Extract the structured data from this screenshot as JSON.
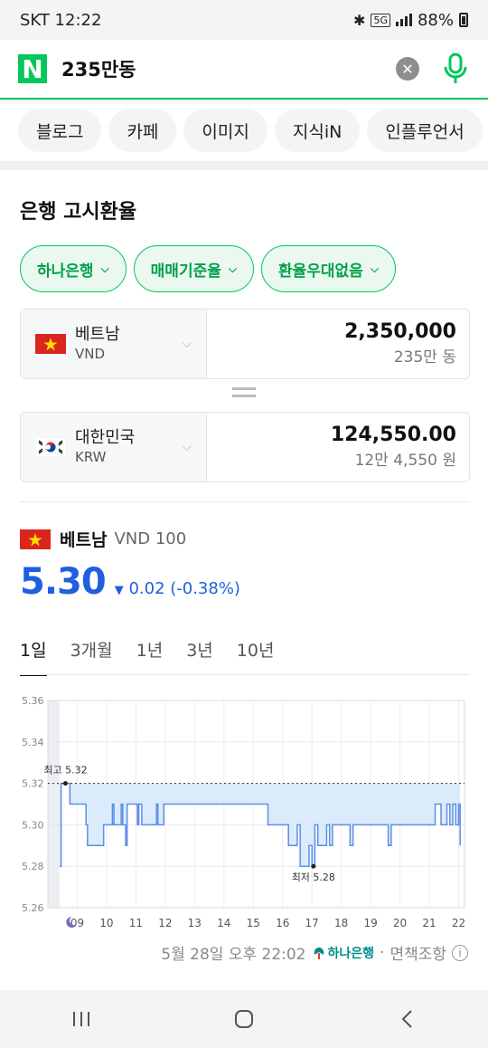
{
  "status_bar": {
    "carrier_time": "SKT 12:22",
    "network": "5G",
    "battery": "88%"
  },
  "search": {
    "query": "235만동",
    "logo": "N",
    "clear_icon": "close-icon",
    "mic_icon": "mic-icon"
  },
  "chips": [
    "블로그",
    "카페",
    "이미지",
    "지식iN",
    "인플루언서"
  ],
  "section_title": "은행 고시환율",
  "filters": [
    "하나은행",
    "매매기준율",
    "환율우대없음"
  ],
  "from": {
    "name": "베트남",
    "code": "VND",
    "amount": "2,350,000",
    "words": "235만 동"
  },
  "to": {
    "name": "대한민국",
    "code": "KRW",
    "amount": "124,550.00",
    "words": "12만 4,550 원"
  },
  "rate": {
    "country": "베트남",
    "unit": "VND 100",
    "value": "5.30",
    "change": "0.02 (-0.38%)",
    "direction": "down",
    "color": "#1f5fe0"
  },
  "tabs": [
    "1일",
    "3개월",
    "1년",
    "3년",
    "10년"
  ],
  "active_tab": 0,
  "footer": {
    "timestamp": "5월 28일 오후 22:02",
    "bank": "하나은행",
    "separator": "·",
    "disclaimer": "면책조항"
  },
  "chart_data": {
    "type": "line",
    "yticks": [
      "5.36",
      "5.34",
      "5.32",
      "5.30",
      "5.28",
      "5.26"
    ],
    "xticks": [
      "09",
      "10",
      "11",
      "12",
      "13",
      "14",
      "15",
      "16",
      "17",
      "18",
      "19",
      "20",
      "21",
      "22"
    ],
    "ylim": [
      5.26,
      5.36
    ],
    "high_label": "최고 5.32",
    "low_label": "최저 5.28",
    "reference": 5.32,
    "x": [
      8.4,
      8.45,
      8.6,
      8.75,
      8.8,
      9.0,
      9.2,
      9.3,
      9.35,
      9.5,
      9.8,
      9.9,
      10.1,
      10.2,
      10.25,
      10.35,
      10.4,
      10.5,
      10.55,
      10.65,
      10.7,
      11.0,
      11.05,
      11.1,
      11.2,
      11.25,
      11.3,
      11.6,
      11.7,
      11.75,
      11.9,
      11.95,
      14.0,
      14.2,
      15.0,
      15.3,
      15.5,
      15.7,
      15.8,
      15.9,
      16.1,
      16.2,
      16.3,
      16.5,
      16.6,
      16.8,
      16.9,
      17.0,
      17.1,
      17.2,
      17.3,
      17.5,
      17.6,
      17.7,
      17.9,
      18.0,
      18.3,
      18.4,
      18.6,
      18.7,
      18.9,
      19.2,
      19.4,
      19.6,
      19.7,
      19.9,
      20.0,
      20.2,
      20.4,
      20.6,
      20.8,
      21.0,
      21.2,
      21.4,
      21.6,
      21.7,
      21.8,
      21.9,
      22.0,
      22.05
    ],
    "values": [
      5.28,
      5.32,
      5.32,
      5.31,
      5.31,
      5.31,
      5.31,
      5.3,
      5.29,
      5.29,
      5.29,
      5.3,
      5.3,
      5.31,
      5.3,
      5.3,
      5.3,
      5.31,
      5.3,
      5.29,
      5.31,
      5.31,
      5.3,
      5.31,
      5.3,
      5.3,
      5.3,
      5.3,
      5.31,
      5.3,
      5.3,
      5.31,
      5.31,
      5.31,
      5.31,
      5.31,
      5.3,
      5.3,
      5.3,
      5.3,
      5.3,
      5.29,
      5.29,
      5.3,
      5.28,
      5.28,
      5.29,
      5.28,
      5.3,
      5.29,
      5.29,
      5.3,
      5.29,
      5.3,
      5.3,
      5.3,
      5.29,
      5.3,
      5.3,
      5.3,
      5.3,
      5.3,
      5.3,
      5.29,
      5.3,
      5.3,
      5.3,
      5.3,
      5.3,
      5.3,
      5.3,
      5.3,
      5.31,
      5.3,
      5.31,
      5.3,
      5.31,
      5.3,
      5.31,
      5.29
    ],
    "colors": {
      "line": "#5b8fe6",
      "fill": "#dcebfb",
      "night": "#eceef1",
      "reference": "#333333"
    }
  }
}
